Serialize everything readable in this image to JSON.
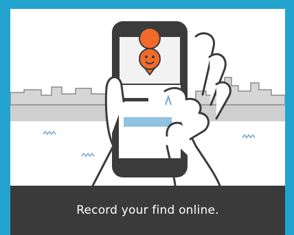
{
  "caption": "Record your find online.",
  "icons": {
    "pin": "smiley-location-pin-icon",
    "phone": "smartphone-icon",
    "hand": "hand-icon",
    "skyline": "city-skyline-icon"
  },
  "colors": {
    "frame": "#22a4cf",
    "card_footer": "#3a3a3a",
    "pin": "#f26a2a",
    "phone_dark": "#3b3b3b",
    "field_blue": "#8fc3e0",
    "skyline": "#c9c9c9"
  }
}
